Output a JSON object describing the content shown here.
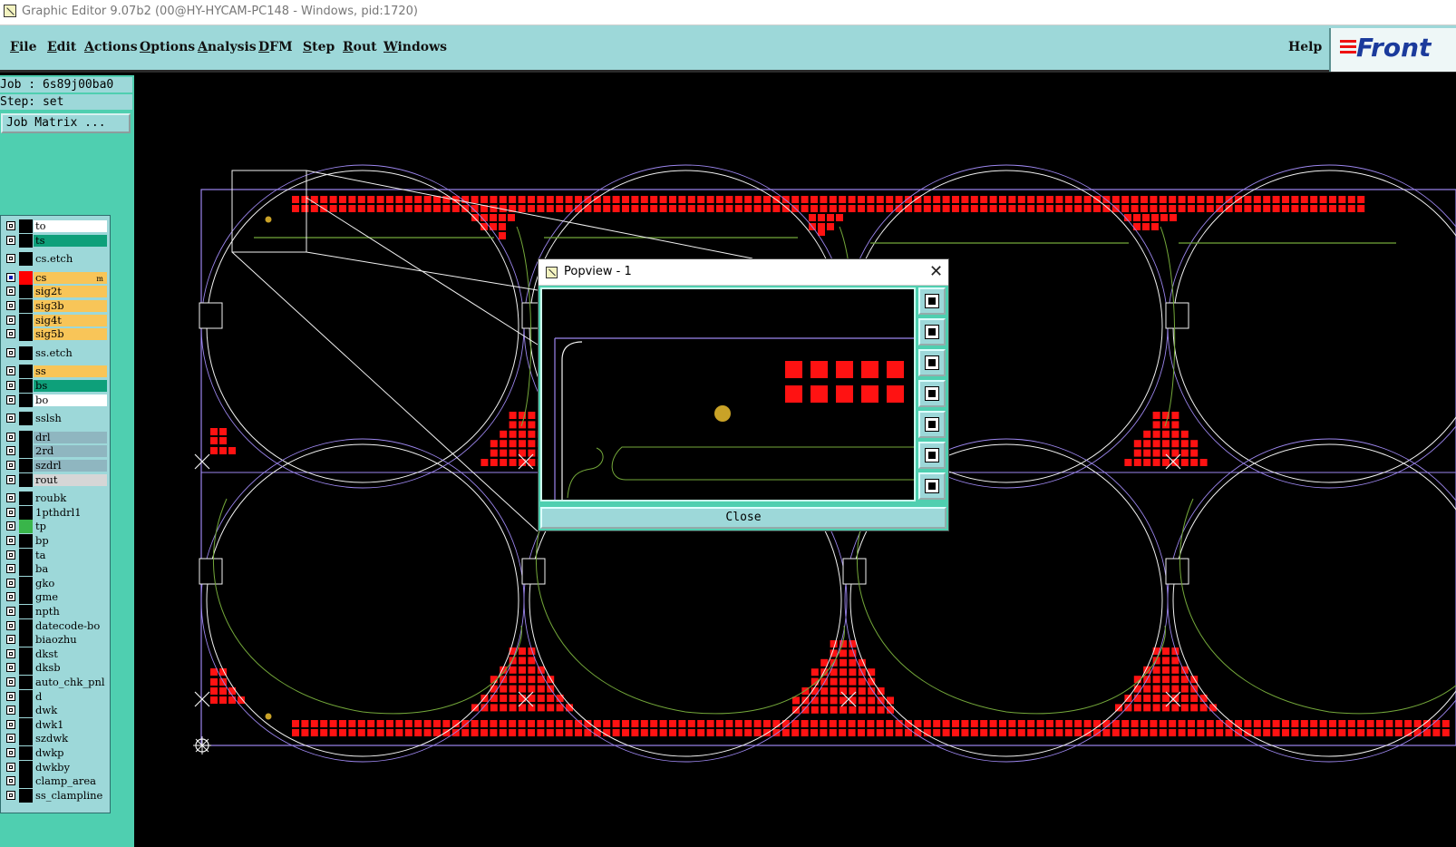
{
  "window": {
    "title": "Graphic Editor 9.07b2 (00@HY-HYCAM-PC148 - Windows, pid:1720)"
  },
  "menu": {
    "items": [
      {
        "label": "File",
        "key": "F",
        "rest": "ile"
      },
      {
        "label": "Edit",
        "key": "E",
        "rest": "dit"
      },
      {
        "label": "Actions",
        "key": "A",
        "rest": "ctions"
      },
      {
        "label": "Options",
        "key": "O",
        "rest": "ptions"
      },
      {
        "label": "Analysis",
        "key": "A",
        "rest": "nalysis"
      },
      {
        "label": "DFM",
        "key": "D",
        "rest": "FM"
      },
      {
        "label": "Step",
        "key": "S",
        "rest": "tep"
      },
      {
        "label": "Rout",
        "key": "R",
        "rest": "out"
      },
      {
        "label": "Windows",
        "key": "W",
        "rest": "indows"
      }
    ],
    "help": "Help",
    "logo": "Front"
  },
  "sidebar": {
    "job": "Job : 6s89j00ba0",
    "step": "Step: set",
    "job_matrix": "Job Matrix ...",
    "layers": [
      {
        "name": "to",
        "color": "#ffffff"
      },
      {
        "name": "ts",
        "color": "#0ea07a"
      },
      {
        "name": "cs.etch",
        "color": "#9dd8d9"
      },
      {
        "name": "cs",
        "color": "#f8c558",
        "active": true,
        "swatch": "#ff0000",
        "tag": "m"
      },
      {
        "name": "sig2t",
        "color": "#f8c558"
      },
      {
        "name": "sig3b",
        "color": "#f8c558"
      },
      {
        "name": "sig4t",
        "color": "#f8c558"
      },
      {
        "name": "sig5b",
        "color": "#f8c558"
      },
      {
        "name": "ss.etch",
        "color": "#9dd8d9"
      },
      {
        "name": "ss",
        "color": "#f8c558"
      },
      {
        "name": "bs",
        "color": "#0ea07a"
      },
      {
        "name": "bo",
        "color": "#ffffff"
      },
      {
        "name": "sslsh",
        "color": "#9dd8d9"
      },
      {
        "name": "drl",
        "color": "#8fb6c0"
      },
      {
        "name": "2rd",
        "color": "#8fb6c0"
      },
      {
        "name": "szdrl",
        "color": "#8fb6c0"
      },
      {
        "name": "rout",
        "color": "#d6d6d6"
      },
      {
        "name": "roubk",
        "color": "#9dd8d9"
      },
      {
        "name": "1pthdrl1",
        "color": "#9dd8d9"
      },
      {
        "name": "tp",
        "color": "#9dd8d9",
        "swatch": "#39b54a"
      },
      {
        "name": "bp",
        "color": "#9dd8d9"
      },
      {
        "name": "ta",
        "color": "#9dd8d9"
      },
      {
        "name": "ba",
        "color": "#9dd8d9"
      },
      {
        "name": "gko",
        "color": "#9dd8d9"
      },
      {
        "name": "gme",
        "color": "#9dd8d9"
      },
      {
        "name": "npth",
        "color": "#9dd8d9"
      },
      {
        "name": "datecode-bo",
        "color": "#9dd8d9"
      },
      {
        "name": "biaozhu",
        "color": "#9dd8d9"
      },
      {
        "name": "dkst",
        "color": "#9dd8d9"
      },
      {
        "name": "dksb",
        "color": "#9dd8d9"
      },
      {
        "name": "auto_chk_pnl",
        "color": "#9dd8d9"
      },
      {
        "name": "d",
        "color": "#9dd8d9"
      },
      {
        "name": "dwk",
        "color": "#9dd8d9"
      },
      {
        "name": "dwk1",
        "color": "#9dd8d9"
      },
      {
        "name": "szdwk",
        "color": "#9dd8d9"
      },
      {
        "name": "dwkp",
        "color": "#9dd8d9"
      },
      {
        "name": "dwkby",
        "color": "#9dd8d9"
      },
      {
        "name": "clamp_area",
        "color": "#9dd8d9"
      },
      {
        "name": "ss_clampline",
        "color": "#9dd8d9"
      }
    ]
  },
  "popview": {
    "title": "Popview - 1",
    "close": "Close",
    "tools": [
      "zoom-window-icon",
      "pan-up-icon",
      "pan-down-icon",
      "pan-left-icon",
      "pan-right-icon",
      "zoom-in-icon",
      "zoom-out-icon"
    ]
  },
  "colors": {
    "pad": "#ff1212",
    "outline": "#9c86ee",
    "profile": "#f2f2f2",
    "trace": "#74a83a",
    "fiducial": "#c9a227",
    "panel": "#9dd8d9",
    "sidebar": "#4fcfb0"
  }
}
